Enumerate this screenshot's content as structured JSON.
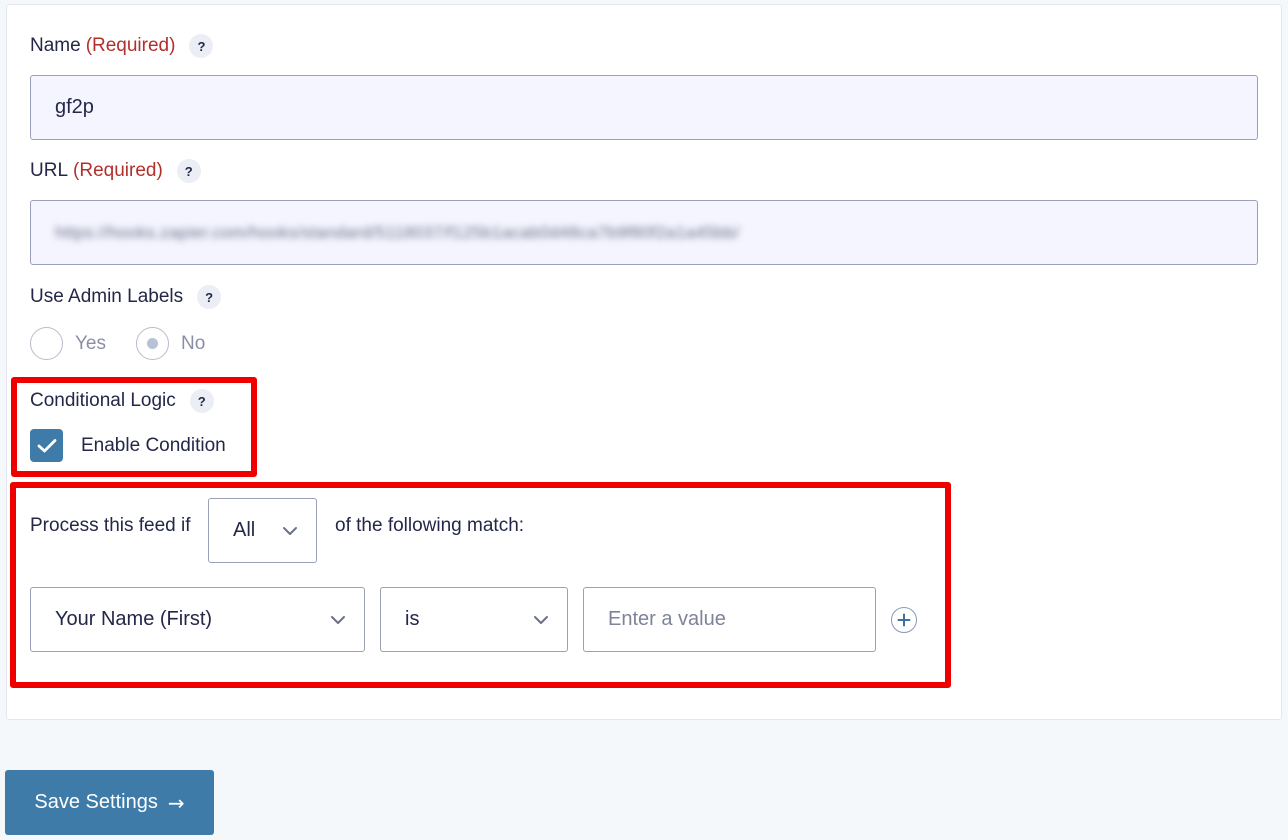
{
  "name_field": {
    "label": "Name",
    "required_text": "(Required)",
    "help_glyph": "?",
    "value": "gf2p"
  },
  "url_field": {
    "label": "URL",
    "required_text": "(Required)",
    "help_glyph": "?",
    "value": "https://hooks.zapier.com/hooks/standard/5118037/f125b1acab0d48ca7b9f80f2a1a45bb/"
  },
  "admin_labels": {
    "label": "Use Admin Labels",
    "help_glyph": "?",
    "options": [
      {
        "label": "Yes",
        "selected": false
      },
      {
        "label": "No",
        "selected": true
      }
    ]
  },
  "conditional_logic": {
    "label": "Conditional Logic",
    "help_glyph": "?",
    "enable_label": "Enable Condition",
    "enabled": true
  },
  "condition_rule": {
    "prefix": "Process this feed if",
    "match_type": "All",
    "suffix": "of the following match:",
    "field": "Your Name (First)",
    "operator": "is",
    "value_placeholder": "Enter a value",
    "add_icon": "plus-circle-icon"
  },
  "save_button": {
    "label": "Save Settings",
    "arrow": "→"
  },
  "colors": {
    "accent": "#3e7ba8",
    "required": "#b2302c",
    "highlight": "#ee0000",
    "input_bg": "#f5f5ff"
  }
}
